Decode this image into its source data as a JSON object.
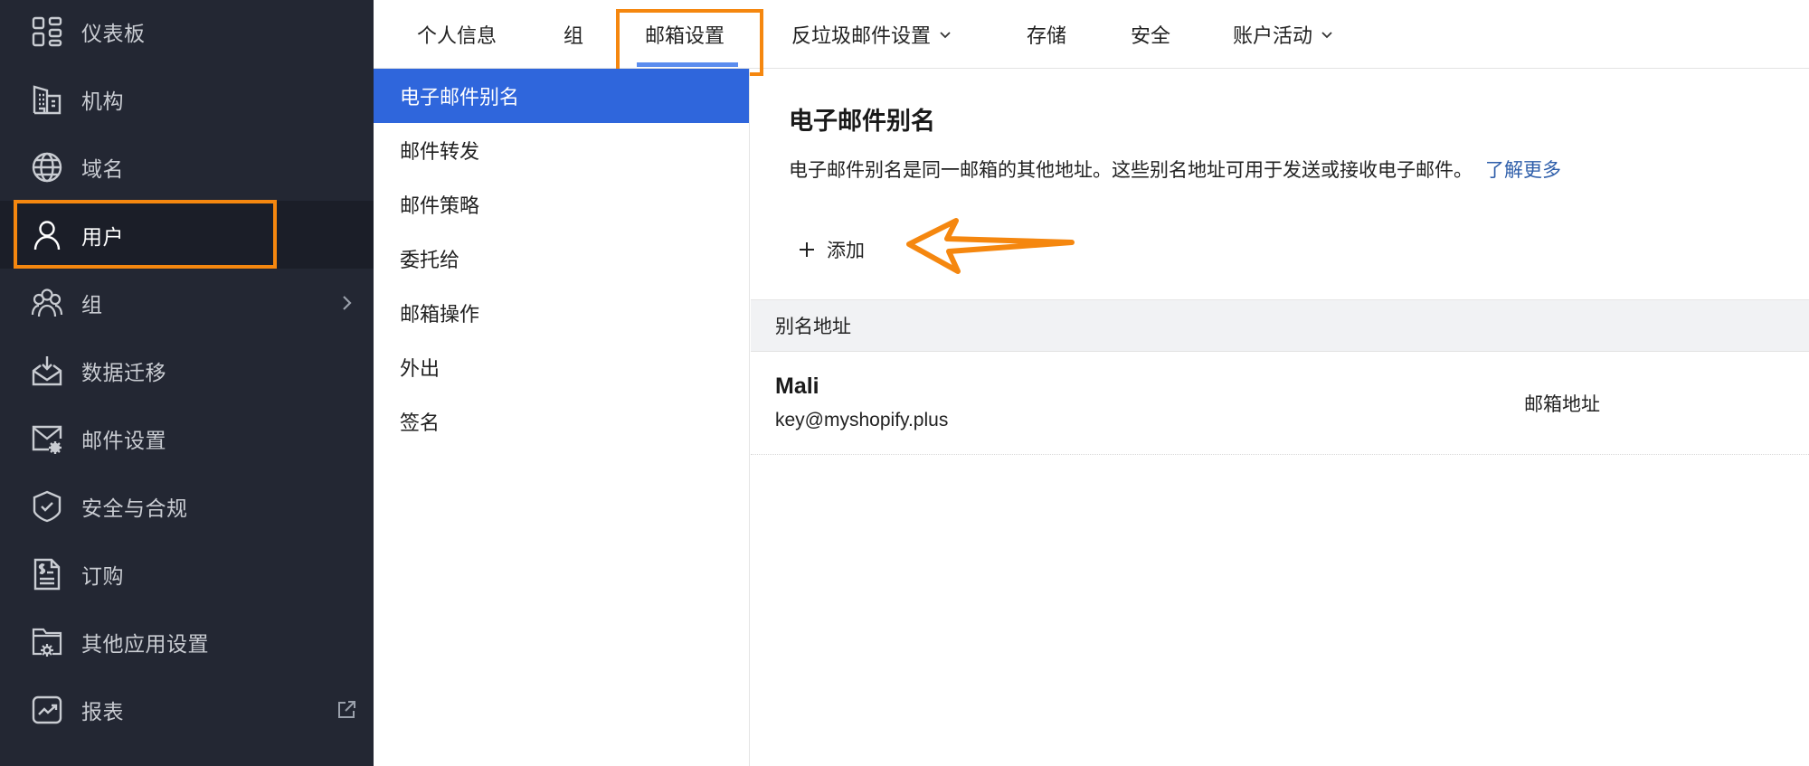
{
  "sidebar": {
    "items": [
      {
        "label": "仪表板",
        "icon": "dashboard-grid-icon"
      },
      {
        "label": "机构",
        "icon": "building-icon"
      },
      {
        "label": "域名",
        "icon": "globe-icon"
      },
      {
        "label": "用户",
        "icon": "user-icon",
        "active": true
      },
      {
        "label": "组",
        "icon": "group-icon",
        "trailing": "chevron-right-icon"
      },
      {
        "label": "数据迁移",
        "icon": "inbox-download-icon"
      },
      {
        "label": "邮件设置",
        "icon": "mail-settings-icon"
      },
      {
        "label": "安全与合规",
        "icon": "shield-check-icon"
      },
      {
        "label": "订购",
        "icon": "invoice-dollar-icon"
      },
      {
        "label": "其他应用设置",
        "icon": "folder-gear-icon"
      },
      {
        "label": "报表",
        "icon": "chart-trend-icon",
        "trailing": "external-link-icon"
      }
    ]
  },
  "tabs": {
    "items": [
      {
        "label": "个人信息"
      },
      {
        "label": "组"
      },
      {
        "label": "邮箱设置",
        "active": true
      },
      {
        "label": "反垃圾邮件设置",
        "dropdown": true
      },
      {
        "label": "存储"
      },
      {
        "label": "安全"
      },
      {
        "label": "账户活动",
        "dropdown": true
      }
    ]
  },
  "subnav": {
    "items": [
      {
        "label": "电子邮件别名",
        "active": true
      },
      {
        "label": "邮件转发"
      },
      {
        "label": "邮件策略"
      },
      {
        "label": "委托给"
      },
      {
        "label": "邮箱操作"
      },
      {
        "label": "外出"
      },
      {
        "label": "签名"
      }
    ]
  },
  "main": {
    "title": "电子邮件别名",
    "description": "电子邮件别名是同一邮箱的其他地址。这些别名地址可用于发送或接收电子邮件。",
    "learn_more": "了解更多",
    "add_label": "添加",
    "table": {
      "header": "别名地址",
      "rows": [
        {
          "name": "Mali",
          "email": "key@myshopify.plus",
          "type": "邮箱地址"
        }
      ]
    }
  },
  "colors": {
    "sidebar_bg": "#232733",
    "accent_blue": "#2f66dc",
    "tab_underline": "#5b8def",
    "annotation_orange": "#f5870f",
    "link": "#2e5eaa"
  }
}
